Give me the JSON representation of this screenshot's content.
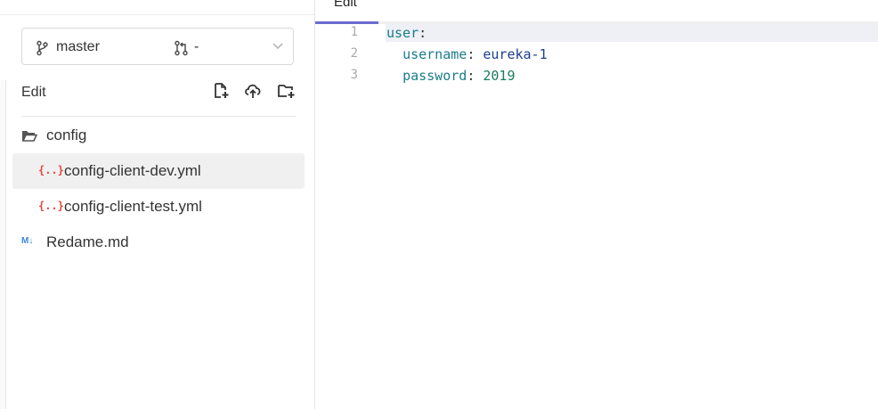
{
  "branch": {
    "name": "master",
    "pr_value": "-"
  },
  "toolbar": {
    "label": "Edit"
  },
  "tree": {
    "items": [
      {
        "label": "config",
        "icon": "folder-open-icon",
        "type": "folder"
      },
      {
        "label": "config-client-dev.yml",
        "icon": "yaml-file-icon",
        "type": "file",
        "selected": true
      },
      {
        "label": "config-client-test.yml",
        "icon": "yaml-file-icon",
        "type": "file"
      },
      {
        "label": "Redame.md",
        "icon": "markdown-file-icon",
        "type": "file"
      }
    ]
  },
  "editor": {
    "tab_label": "Edit",
    "lines": [
      {
        "num": "1",
        "indent": "",
        "key": "user",
        "colon": ":",
        "value": ""
      },
      {
        "num": "2",
        "indent": "  ",
        "key": "username",
        "colon": ": ",
        "value": "eureka-1"
      },
      {
        "num": "3",
        "indent": "  ",
        "key": "password",
        "colon": ": ",
        "value": "2019"
      }
    ]
  },
  "colors": {
    "tab_accent": "#6b6bd1",
    "yaml_icon": "#e5483f",
    "markdown_icon": "#3d8ad6"
  }
}
